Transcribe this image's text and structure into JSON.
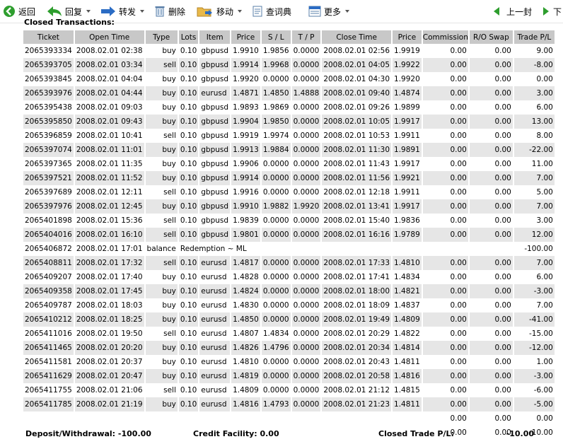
{
  "toolbar": {
    "back": "返回",
    "reply": "回复",
    "forward": "转发",
    "delete": "删除",
    "move": "移动",
    "dictionary": "查词典",
    "more": "更多",
    "prev": "上一封",
    "next": "下"
  },
  "section_title": "Closed Transactions:",
  "columns": [
    "Ticket",
    "Open Time",
    "Type",
    "Lots",
    "Item",
    "Price",
    "S / L",
    "T / P",
    "Close Time",
    "Price",
    "Commission",
    "R/O Swap",
    "Trade P/L"
  ],
  "rows": [
    [
      "2065393334",
      "2008.02.01 02:38",
      "buy",
      "0.10",
      "gbpusd",
      "1.9910",
      "1.9856",
      "0.0000",
      "2008.02.01 02:56",
      "1.9919",
      "0.00",
      "0.00",
      "9.00"
    ],
    [
      "2065393705",
      "2008.02.01 03:34",
      "sell",
      "0.10",
      "gbpusd",
      "1.9914",
      "1.9968",
      "0.0000",
      "2008.02.01 04:05",
      "1.9922",
      "0.00",
      "0.00",
      "-8.00"
    ],
    [
      "2065393845",
      "2008.02.01 04:04",
      "buy",
      "0.10",
      "gbpusd",
      "1.9920",
      "0.0000",
      "0.0000",
      "2008.02.01 04:30",
      "1.9920",
      "0.00",
      "0.00",
      "0.00"
    ],
    [
      "2065393976",
      "2008.02.01 04:44",
      "buy",
      "0.10",
      "eurusd",
      "1.4871",
      "1.4850",
      "1.4888",
      "2008.02.01 09:40",
      "1.4874",
      "0.00",
      "0.00",
      "3.00"
    ],
    [
      "2065395438",
      "2008.02.01 09:03",
      "buy",
      "0.10",
      "gbpusd",
      "1.9893",
      "1.9869",
      "0.0000",
      "2008.02.01 09:26",
      "1.9899",
      "0.00",
      "0.00",
      "6.00"
    ],
    [
      "2065395850",
      "2008.02.01 09:43",
      "buy",
      "0.10",
      "gbpusd",
      "1.9904",
      "1.9850",
      "0.0000",
      "2008.02.01 10:05",
      "1.9917",
      "0.00",
      "0.00",
      "13.00"
    ],
    [
      "2065396859",
      "2008.02.01 10:41",
      "sell",
      "0.10",
      "gbpusd",
      "1.9919",
      "1.9974",
      "0.0000",
      "2008.02.01 10:53",
      "1.9911",
      "0.00",
      "0.00",
      "8.00"
    ],
    [
      "2065397074",
      "2008.02.01 11:01",
      "buy",
      "0.10",
      "gbpusd",
      "1.9913",
      "1.9884",
      "0.0000",
      "2008.02.01 11:30",
      "1.9891",
      "0.00",
      "0.00",
      "-22.00"
    ],
    [
      "2065397365",
      "2008.02.01 11:35",
      "buy",
      "0.10",
      "gbpusd",
      "1.9906",
      "0.0000",
      "0.0000",
      "2008.02.01 11:43",
      "1.9917",
      "0.00",
      "0.00",
      "11.00"
    ],
    [
      "2065397521",
      "2008.02.01 11:52",
      "buy",
      "0.10",
      "gbpusd",
      "1.9914",
      "0.0000",
      "0.0000",
      "2008.02.01 11:56",
      "1.9921",
      "0.00",
      "0.00",
      "7.00"
    ],
    [
      "2065397689",
      "2008.02.01 12:11",
      "sell",
      "0.10",
      "gbpusd",
      "1.9916",
      "0.0000",
      "0.0000",
      "2008.02.01 12:18",
      "1.9911",
      "0.00",
      "0.00",
      "5.00"
    ],
    [
      "2065397976",
      "2008.02.01 12:45",
      "buy",
      "0.10",
      "gbpusd",
      "1.9910",
      "1.9882",
      "1.9920",
      "2008.02.01 13:41",
      "1.9917",
      "0.00",
      "0.00",
      "7.00"
    ],
    [
      "2065401898",
      "2008.02.01 15:36",
      "sell",
      "0.10",
      "gbpusd",
      "1.9839",
      "0.0000",
      "0.0000",
      "2008.02.01 15:40",
      "1.9836",
      "0.00",
      "0.00",
      "3.00"
    ],
    [
      "2065404016",
      "2008.02.01 16:10",
      "sell",
      "0.10",
      "gbpusd",
      "1.9801",
      "0.0000",
      "0.0000",
      "2008.02.01 16:16",
      "1.9789",
      "0.00",
      "0.00",
      "12.00"
    ],
    [
      "2065406872",
      "2008.02.01 17:01",
      "balance",
      "Redemption ~ ML",
      "",
      "",
      "",
      "",
      "",
      "",
      "",
      "",
      "-100.00"
    ],
    [
      "2065408811",
      "2008.02.01 17:32",
      "sell",
      "0.10",
      "eurusd",
      "1.4817",
      "0.0000",
      "0.0000",
      "2008.02.01 17:33",
      "1.4810",
      "0.00",
      "0.00",
      "7.00"
    ],
    [
      "2065409207",
      "2008.02.01 17:40",
      "buy",
      "0.10",
      "eurusd",
      "1.4828",
      "0.0000",
      "0.0000",
      "2008.02.01 17:41",
      "1.4834",
      "0.00",
      "0.00",
      "6.00"
    ],
    [
      "2065409358",
      "2008.02.01 17:45",
      "buy",
      "0.10",
      "eurusd",
      "1.4824",
      "0.0000",
      "0.0000",
      "2008.02.01 18:00",
      "1.4821",
      "0.00",
      "0.00",
      "-3.00"
    ],
    [
      "2065409787",
      "2008.02.01 18:03",
      "buy",
      "0.10",
      "eurusd",
      "1.4830",
      "0.0000",
      "0.0000",
      "2008.02.01 18:09",
      "1.4837",
      "0.00",
      "0.00",
      "7.00"
    ],
    [
      "2065410212",
      "2008.02.01 18:25",
      "buy",
      "0.10",
      "eurusd",
      "1.4850",
      "0.0000",
      "0.0000",
      "2008.02.01 19:49",
      "1.4809",
      "0.00",
      "0.00",
      "-41.00"
    ],
    [
      "2065411016",
      "2008.02.01 19:50",
      "sell",
      "0.10",
      "eurusd",
      "1.4807",
      "1.4834",
      "0.0000",
      "2008.02.01 20:29",
      "1.4822",
      "0.00",
      "0.00",
      "-15.00"
    ],
    [
      "2065411465",
      "2008.02.01 20:20",
      "buy",
      "0.10",
      "eurusd",
      "1.4826",
      "1.4796",
      "0.0000",
      "2008.02.01 20:34",
      "1.4814",
      "0.00",
      "0.00",
      "-12.00"
    ],
    [
      "2065411581",
      "2008.02.01 20:37",
      "buy",
      "0.10",
      "eurusd",
      "1.4810",
      "0.0000",
      "0.0000",
      "2008.02.01 20:43",
      "1.4811",
      "0.00",
      "0.00",
      "1.00"
    ],
    [
      "2065411629",
      "2008.02.01 20:47",
      "buy",
      "0.10",
      "eurusd",
      "1.4819",
      "0.0000",
      "0.0000",
      "2008.02.01 20:58",
      "1.4816",
      "0.00",
      "0.00",
      "-3.00"
    ],
    [
      "2065411755",
      "2008.02.01 21:06",
      "sell",
      "0.10",
      "eurusd",
      "1.4809",
      "0.0000",
      "0.0000",
      "2008.02.01 21:12",
      "1.4815",
      "0.00",
      "0.00",
      "-6.00"
    ],
    [
      "2065411785",
      "2008.02.01 21:19",
      "buy",
      "0.10",
      "eurusd",
      "1.4816",
      "1.4793",
      "0.0000",
      "2008.02.01 21:23",
      "1.4811",
      "0.00",
      "0.00",
      "-5.00"
    ]
  ],
  "totals": [
    [
      "0.00",
      "0.00",
      "0.00"
    ],
    [
      "0.00",
      "0.00",
      "-10.00"
    ]
  ],
  "summary": {
    "deposit": "Deposit/Withdrawal: -100.00",
    "credit": "Credit Facility: 0.00",
    "closed_label": "Closed Trade P/L:",
    "closed_value": "-10.00"
  },
  "colors": {
    "header_bg": "#c8c8c8",
    "alt_row_bg": "#e6e6e6",
    "icon_green": "#2e9e2e",
    "icon_blue": "#2b6cc4"
  }
}
